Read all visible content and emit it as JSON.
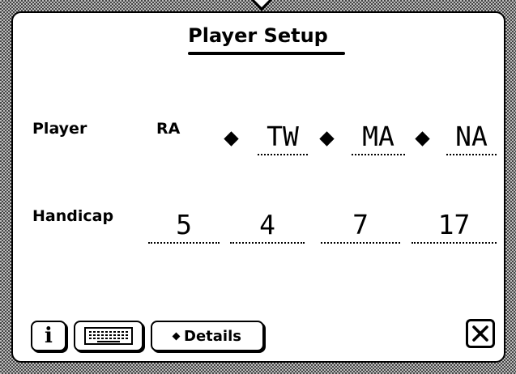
{
  "window": {
    "title": "Player Setup"
  },
  "players": {
    "label": "Player",
    "fixed": "RA",
    "entries": [
      "TW",
      "MA",
      "NA"
    ]
  },
  "handicap": {
    "label": "Handicap",
    "values": [
      "5",
      "4",
      "7",
      "17"
    ]
  },
  "toolbar": {
    "info_label": "i",
    "keyboard_icon": "keyboard-icon",
    "details_label": "Details",
    "close_icon": "close-icon"
  }
}
